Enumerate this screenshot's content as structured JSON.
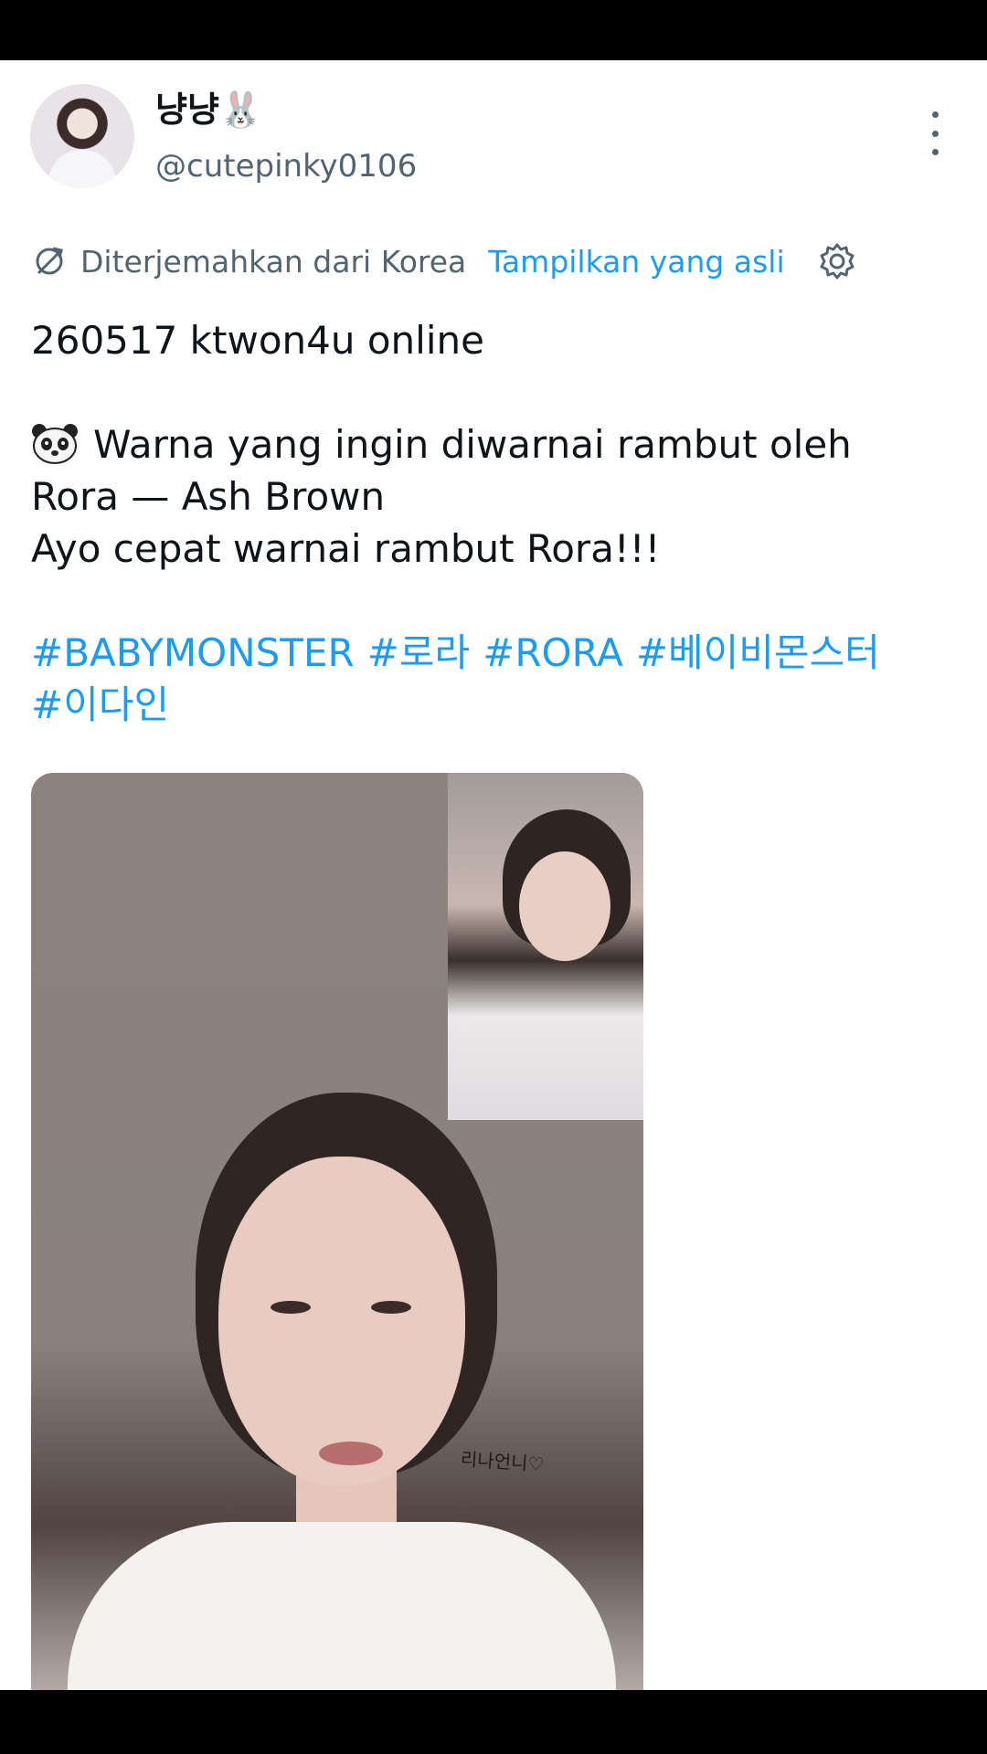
{
  "tweet": {
    "display_name": "냥냥🐰",
    "handle": "@cutepinky0106"
  },
  "translation": {
    "source_label": "Diterjemahkan dari Korea",
    "show_original": "Tampilkan yang asli"
  },
  "body": {
    "line1": "260517 ktwon4u online",
    "line2": "Warna yang ingin diwarnai rambut oleh",
    "line3": "Rora — Ash Brown",
    "line4": "Ayo cepat warnai rambut Rora!!!"
  },
  "hashtags": [
    "#BABYMONSTER",
    "#로라",
    "#RORA",
    "#베이비몬스터",
    "#이다인"
  ],
  "media": {
    "signature": "리나언니♡"
  },
  "icons": {
    "translate": "translate-icon",
    "settings": "gear-icon",
    "more": "more-vertical-icon",
    "emoji": "panda-emoji"
  },
  "colors": {
    "accent": "#1d9bf0",
    "secondary_text": "#536471",
    "primary_text": "#0f1419"
  }
}
